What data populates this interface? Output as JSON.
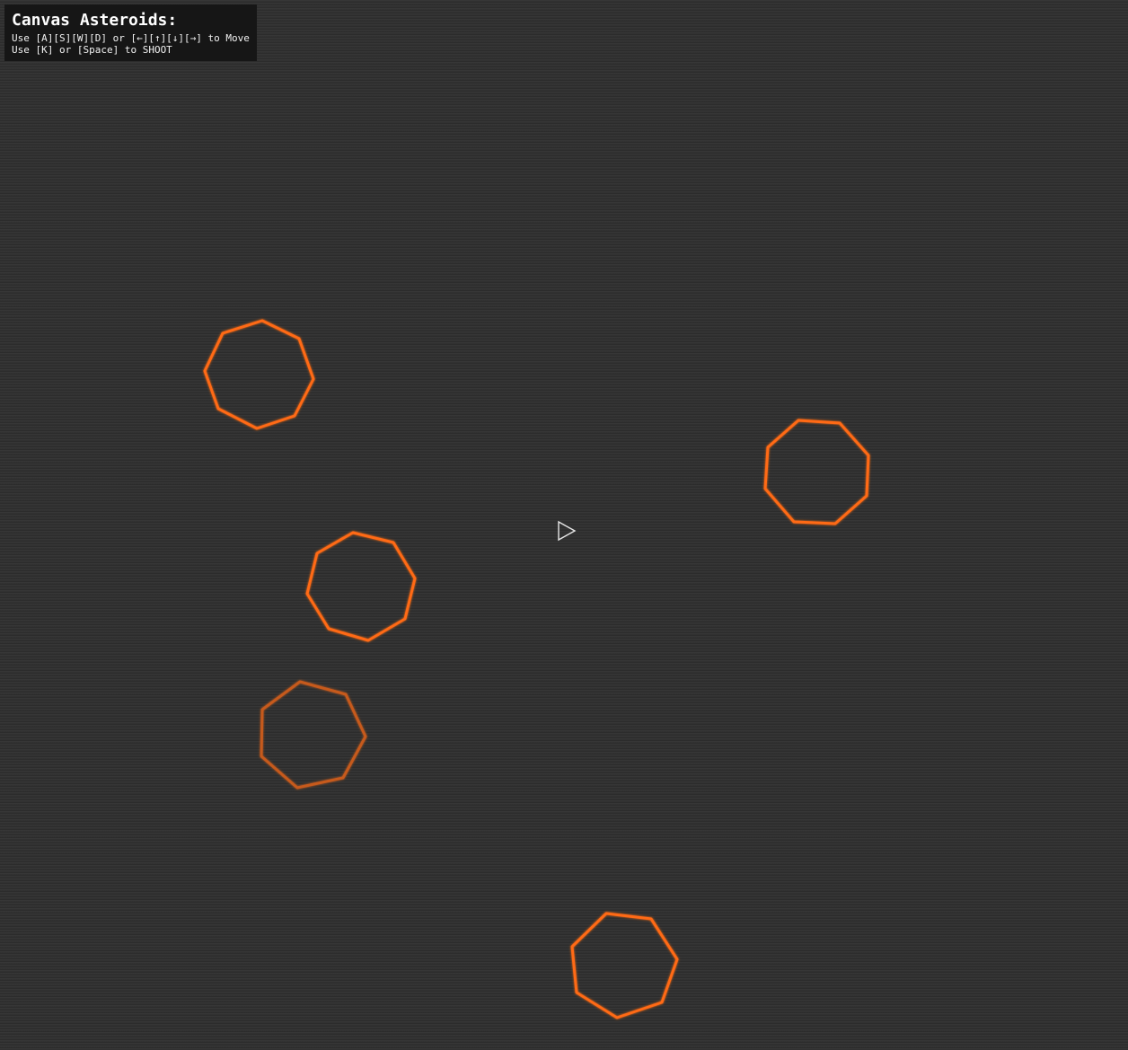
{
  "hud": {
    "title": "Canvas Asteroids:",
    "move_help": "Use [A][S][W][D] or [←][↑][↓][→] to Move",
    "shoot_help": "Use [K] or [Space] to SHOOT"
  },
  "colors": {
    "asteroid": "#ff6a12",
    "asteroid_dim": "#c65a1f",
    "ship": "#e6e6e6",
    "background": "#2f2f2f",
    "hud_panel": "#161616"
  },
  "game": {
    "asteroid_count": 5,
    "ship_heading": "right",
    "ship_icon": "ship-triangle-icon"
  }
}
